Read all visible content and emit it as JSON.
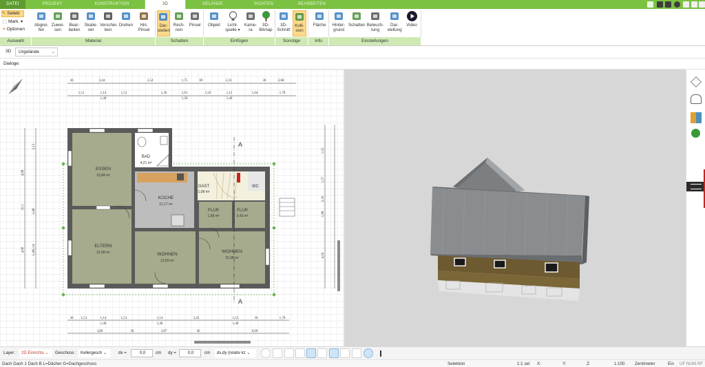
{
  "tabs": [
    "DATEI",
    "PROJEKT",
    "KONSTRUKTION",
    "3D",
    "GELÄNDE",
    "SICHTEN",
    "BEARBEITEN"
  ],
  "active_tab": "3D",
  "colors": {
    "accent": "#7bc142",
    "group_bg": "#cfe9b4",
    "selected": "#fcd98a",
    "wall": "#5a5a5a",
    "floor": "#a5ab8c",
    "kitchen": "#d7a160",
    "facade": "#6e5a30",
    "roof": "#8a8d90"
  },
  "auswahl": {
    "selekt": "Selekt",
    "mark": "Mark.",
    "optionen": "Optionen",
    "group": "Auswahl"
  },
  "ribbon_groups": [
    {
      "name": "Material",
      "buttons": [
        {
          "label": "Abgrei-\nfen",
          "icon": "eyedropper-icon"
        },
        {
          "label": "Zuwei-\nsen",
          "icon": "paint-bucket-icon"
        },
        {
          "label": "Bear-\nbeiten",
          "icon": "edit-material-icon"
        },
        {
          "label": "Skalie-\nren",
          "icon": "scale-icon"
        },
        {
          "label": "Verschie-\nben",
          "icon": "move-icon"
        },
        {
          "label": "Drehen",
          "icon": "rotate-icon"
        },
        {
          "label": "Hin.\nPinsel",
          "icon": "brush-icon"
        }
      ]
    },
    {
      "name": "Schatten",
      "buttons": [
        {
          "label": "Dar-\nstellen",
          "icon": "shadow-show-icon",
          "selected": true
        },
        {
          "label": "Rech-\nnen",
          "icon": "shadow-calc-icon"
        },
        {
          "label": "Pinsel",
          "icon": "shadow-brush-icon"
        }
      ]
    },
    {
      "name": "Einfügen",
      "buttons": [
        {
          "label": "Objekt",
          "icon": "object-icon"
        },
        {
          "label": "Licht-\nquelle ▾",
          "icon": "lightbulb-icon"
        },
        {
          "label": "Kame-\nra",
          "icon": "camera-icon"
        },
        {
          "label": "3D-\nBitmap",
          "icon": "tree-icon"
        }
      ]
    },
    {
      "name": "Sonstige",
      "buttons": [
        {
          "label": "3D-\nSchnitt",
          "icon": "section-icon"
        },
        {
          "label": "Kolli-\nsion",
          "icon": "collision-icon",
          "selected": true
        }
      ]
    },
    {
      "name": "Info",
      "buttons": [
        {
          "label": "Fläche",
          "icon": "area-info-icon"
        }
      ]
    },
    {
      "name": "Einstellungen",
      "buttons": [
        {
          "label": "Hinter-\ngrund",
          "icon": "background-icon"
        },
        {
          "label": "Schatten",
          "icon": "house-shadow-icon"
        },
        {
          "label": "Beleuch-\ntung",
          "icon": "lighting-icon"
        },
        {
          "label": "Dar-\nstellung",
          "icon": "display-icon"
        },
        {
          "label": "Video",
          "icon": "play-icon"
        }
      ]
    }
  ],
  "view": {
    "mode": "3D",
    "terrain": "Urgelände"
  },
  "dialoge_label": "Dialoge:",
  "rooms": [
    {
      "name": "ESSEN",
      "area": "15,84 m²"
    },
    {
      "name": "BAD",
      "area": "4,21 m²"
    },
    {
      "name": "KÜCHE",
      "area": "12,17 m²"
    },
    {
      "name": "GAST",
      "area": "1,08 m²"
    },
    {
      "name": "WC",
      "area": ""
    },
    {
      "name": "FLUR",
      "area": "1,98 m²"
    },
    {
      "name": "FLUR",
      "area": "3,43 m²"
    },
    {
      "name": "ELTERN",
      "area": "15,68 m²"
    },
    {
      "name": "WOHNEN",
      "area": "13,59 m²"
    },
    {
      "name": "WOHNEN",
      "area": "15,38 m²"
    }
  ],
  "dims_top_1": [
    "36",
    "3,44",
    "2,52",
    "1,75",
    "69",
    "2,33",
    "36",
    "2,68"
  ],
  "dims_top_2": [
    "1,51",
    "1,14",
    "1,51",
    "1,26",
    "1,01",
    "1,50",
    "1,12",
    "1,64",
    "1,70"
  ],
  "dims_top_2b": [
    "1,40",
    "1,20",
    "1,40"
  ],
  "dims_bottom_1": [
    "36",
    "1,51",
    "1,14",
    "1,51",
    "1,14",
    "3,45",
    "1,55",
    "36",
    "1,70"
  ],
  "dims_bottom_1b": [
    "1,40",
    "1,40",
    "1,40"
  ],
  "dims_bottom_2": [
    "3,80",
    "36",
    "3,87",
    "36",
    "6,09"
  ],
  "dims_left_1": [
    "10,1",
    "4,68",
    "4,60"
  ],
  "dims_left_2": [
    "3,13",
    "3,48",
    "1,14",
    "1,40"
  ],
  "dims_right": [
    "1,55",
    "1,57",
    "2,16",
    "1,98",
    "4,16"
  ],
  "axis_label": "A",
  "bottombar": {
    "layer_label": "Layer :",
    "layer_value": "2D Einrichtu",
    "geschoss_label": "Geschoss :",
    "geschoss_value": "Kellergesch",
    "dx_label": "dx =",
    "dx_value": "0,0",
    "unit1": "cm",
    "dy_label": "dy =",
    "dy_value": "0,0",
    "unit2": "cm",
    "mode_value": "dx,dy (relativ kz"
  },
  "status": {
    "hint": "Dach Dach 1 Dach B L=Dächer G=Dachgeschoss",
    "mode": "Selektion",
    "scale_sel": "1:1 sel",
    "x": "X:",
    "y": "Y:",
    "z": "Z:",
    "scale": "1:100",
    "unit": "Zentimeter",
    "ein": "Ein",
    "flags": "UF NUM RF"
  }
}
